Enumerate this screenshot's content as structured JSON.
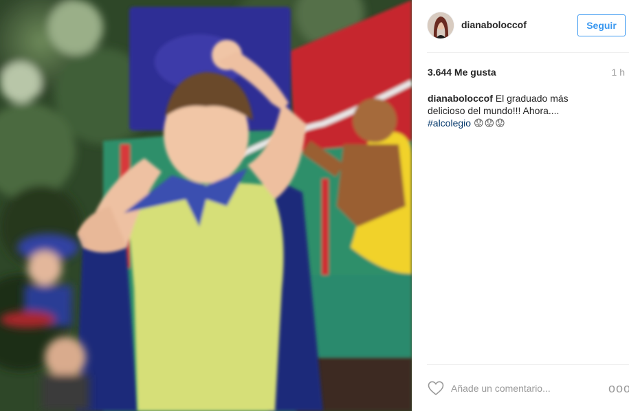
{
  "post": {
    "username": "dianaboloccof",
    "follow_label": "Seguir",
    "likes": "3.644 Me gusta",
    "time_ago": "1 h",
    "caption": {
      "username": "dianaboloccof",
      "text": " El graduado más delicioso del mundo!!! Ahora....",
      "hashtag": "#alcolegio",
      "emoji": "😟😟😟"
    },
    "comment_placeholder": "Añade un comentario...",
    "more_label": "ooo"
  },
  "icons": {
    "heart": "heart-outline-icon",
    "more": "more-options-icon"
  },
  "colors": {
    "accent": "#3897f0",
    "hashtag": "#003569",
    "muted": "#999999",
    "text": "#262626"
  }
}
